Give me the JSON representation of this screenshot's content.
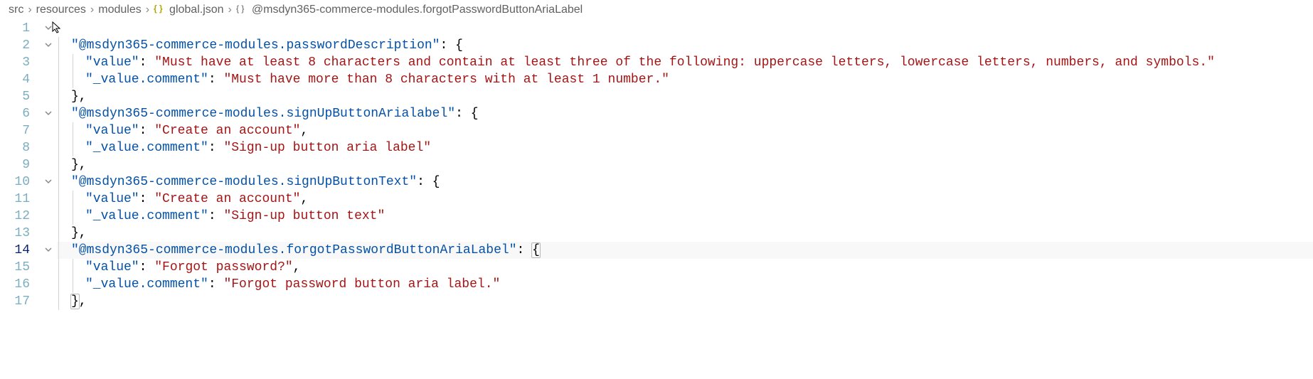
{
  "breadcrumb": {
    "parts": [
      "src",
      "resources",
      "modules"
    ],
    "file": "global.json",
    "symbol_prefix": "@msdyn365-commerce-modules.forgotPasswordButtonAriaLabel"
  },
  "lines": [
    {
      "n": 1,
      "fold": true,
      "indent": 0,
      "tokens": []
    },
    {
      "n": 2,
      "fold": true,
      "indent": 1,
      "tokens": [
        {
          "t": "key",
          "v": "\"@msdyn365-commerce-modules.passwordDescription\""
        },
        {
          "t": "punc",
          "v": ": {"
        }
      ]
    },
    {
      "n": 3,
      "fold": false,
      "indent": 2,
      "tokens": [
        {
          "t": "key",
          "v": "\"value\""
        },
        {
          "t": "punc",
          "v": ": "
        },
        {
          "t": "str",
          "v": "\"Must have at least 8 characters and contain at least three of the following: uppercase letters, lowercase letters, numbers, and symbols.\""
        }
      ]
    },
    {
      "n": 4,
      "fold": false,
      "indent": 2,
      "tokens": [
        {
          "t": "key",
          "v": "\"_value.comment\""
        },
        {
          "t": "punc",
          "v": ": "
        },
        {
          "t": "str",
          "v": "\"Must have more than 8 characters with at least 1 number.\""
        }
      ]
    },
    {
      "n": 5,
      "fold": false,
      "indent": 1,
      "tokens": [
        {
          "t": "punc",
          "v": "},"
        }
      ]
    },
    {
      "n": 6,
      "fold": true,
      "indent": 1,
      "tokens": [
        {
          "t": "key",
          "v": "\"@msdyn365-commerce-modules.signUpButtonArialabel\""
        },
        {
          "t": "punc",
          "v": ": {"
        }
      ]
    },
    {
      "n": 7,
      "fold": false,
      "indent": 2,
      "tokens": [
        {
          "t": "key",
          "v": "\"value\""
        },
        {
          "t": "punc",
          "v": ": "
        },
        {
          "t": "str",
          "v": "\"Create an account\""
        },
        {
          "t": "punc",
          "v": ","
        }
      ]
    },
    {
      "n": 8,
      "fold": false,
      "indent": 2,
      "tokens": [
        {
          "t": "key",
          "v": "\"_value.comment\""
        },
        {
          "t": "punc",
          "v": ": "
        },
        {
          "t": "str",
          "v": "\"Sign-up button aria label\""
        }
      ]
    },
    {
      "n": 9,
      "fold": false,
      "indent": 1,
      "tokens": [
        {
          "t": "punc",
          "v": "},"
        }
      ]
    },
    {
      "n": 10,
      "fold": true,
      "indent": 1,
      "tokens": [
        {
          "t": "key",
          "v": "\"@msdyn365-commerce-modules.signUpButtonText\""
        },
        {
          "t": "punc",
          "v": ": {"
        }
      ]
    },
    {
      "n": 11,
      "fold": false,
      "indent": 2,
      "tokens": [
        {
          "t": "key",
          "v": "\"value\""
        },
        {
          "t": "punc",
          "v": ": "
        },
        {
          "t": "str",
          "v": "\"Create an account\""
        },
        {
          "t": "punc",
          "v": ","
        }
      ]
    },
    {
      "n": 12,
      "fold": false,
      "indent": 2,
      "tokens": [
        {
          "t": "key",
          "v": "\"_value.comment\""
        },
        {
          "t": "punc",
          "v": ": "
        },
        {
          "t": "str",
          "v": "\"Sign-up button text\""
        }
      ]
    },
    {
      "n": 13,
      "fold": false,
      "indent": 1,
      "tokens": [
        {
          "t": "punc",
          "v": "},"
        }
      ]
    },
    {
      "n": 14,
      "fold": true,
      "indent": 1,
      "active": true,
      "tokens": [
        {
          "t": "key",
          "v": "\"@msdyn365-commerce-modules.forgotPasswordButtonAriaLabel\""
        },
        {
          "t": "punc",
          "v": ": "
        },
        {
          "t": "punc",
          "v": "{",
          "match": true
        }
      ]
    },
    {
      "n": 15,
      "fold": false,
      "indent": 2,
      "tokens": [
        {
          "t": "key",
          "v": "\"value\""
        },
        {
          "t": "punc",
          "v": ": "
        },
        {
          "t": "str",
          "v": "\"Forgot password?\""
        },
        {
          "t": "punc",
          "v": ","
        }
      ]
    },
    {
      "n": 16,
      "fold": false,
      "indent": 2,
      "tokens": [
        {
          "t": "key",
          "v": "\"_value.comment\""
        },
        {
          "t": "punc",
          "v": ": "
        },
        {
          "t": "str",
          "v": "\"Forgot password button aria label.\""
        }
      ]
    },
    {
      "n": 17,
      "fold": false,
      "indent": 1,
      "tokens": [
        {
          "t": "punc",
          "v": "}",
          "match": true
        },
        {
          "t": "punc",
          "v": ","
        }
      ]
    }
  ]
}
